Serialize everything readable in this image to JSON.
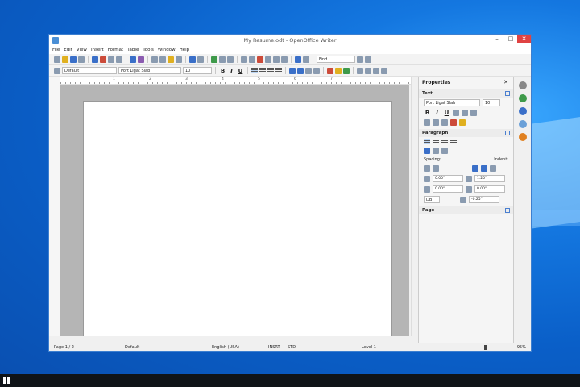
{
  "window": {
    "title": "My Resume.odt - OpenOffice Writer",
    "minimize": "–",
    "maximize": "□",
    "close": "✕"
  },
  "menu": [
    "File",
    "Edit",
    "View",
    "Insert",
    "Format",
    "Table",
    "Tools",
    "Window",
    "Help"
  ],
  "toolbar2": {
    "style": "Default",
    "font": "Port Ligat Slab",
    "size": "10",
    "bold": "B",
    "italic": "I",
    "underline": "U"
  },
  "toolbar1": {
    "find_box": "Find"
  },
  "ruler": [
    "1",
    "2",
    "3",
    "4",
    "5",
    "6",
    "7"
  ],
  "sidebar": {
    "title": "Properties",
    "close": "✕",
    "text_section": "Text",
    "font": "Port Ligat Slab",
    "size": "10",
    "paragraph_section": "Paragraph",
    "spacing_label": "Spacing:",
    "indent_label": "Indent:",
    "above": "0.00\"",
    "below": "0.00\"",
    "before": "1.25\"",
    "after": "0.00\"",
    "line": "DB",
    "first": "-0.25\"",
    "page_section": "Page"
  },
  "status": {
    "page": "Page 1 / 2",
    "style": "Default",
    "language": "English (USA)",
    "insert": "INSRT",
    "selection": "STD",
    "level": "Level 1",
    "zoom": "95%"
  }
}
